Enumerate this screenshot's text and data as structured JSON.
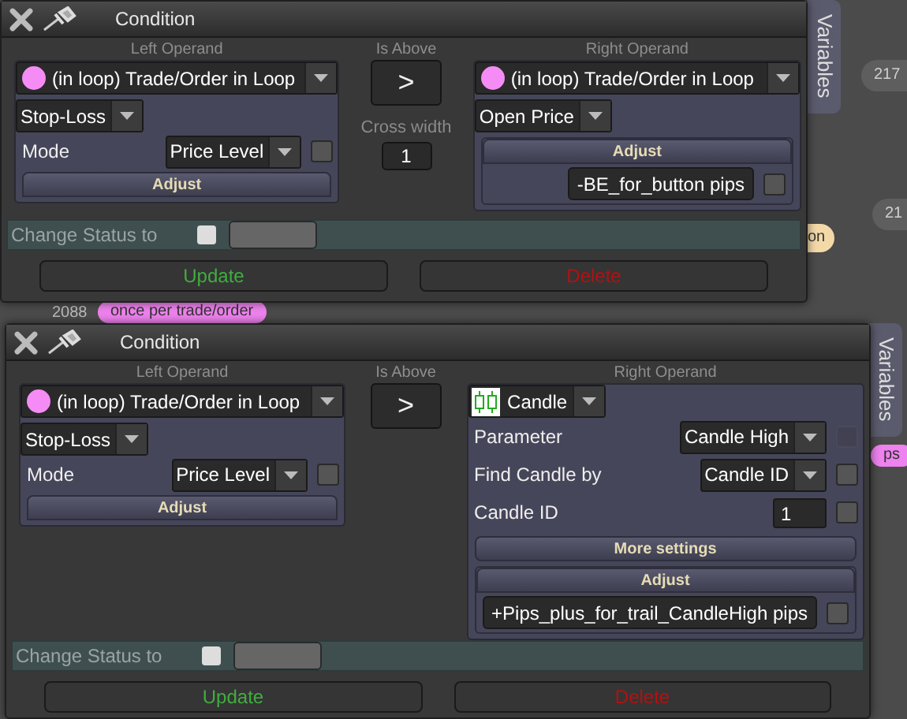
{
  "background": {
    "nodes": [
      {
        "kind": "gray",
        "label": "217"
      },
      {
        "kind": "gray",
        "label": "21"
      },
      {
        "kind": "beige",
        "label": "on"
      },
      {
        "kind": "number",
        "label": "2088"
      },
      {
        "kind": "pink",
        "label": "once per trade/order"
      },
      {
        "kind": "pink",
        "label": "ps"
      }
    ]
  },
  "dialogs": [
    {
      "title": "Condition",
      "side_tab": "Variables",
      "left_operand": {
        "heading": "Left Operand",
        "source": {
          "kind": "loop",
          "label": "(in loop) Trade/Order in Loop"
        },
        "field": "Stop-Loss",
        "rows": [
          {
            "kind": "dropdown",
            "label": "Mode",
            "value": "Price Level",
            "checked": false,
            "disabled": false
          }
        ],
        "adjust": "Adjust"
      },
      "operator": {
        "heading": "Is Above",
        "symbol": ">",
        "cross_width": {
          "label": "Cross width",
          "value": "1"
        }
      },
      "right_operand": {
        "heading": "Right Operand",
        "source": {
          "kind": "loop",
          "label": "(in loop) Trade/Order in Loop"
        },
        "field": "Open Price",
        "adjust": "Adjust",
        "adjust_value": "-BE_for_button pips",
        "adjust_checked": false
      },
      "change_status": {
        "label": "Change Status to",
        "checked": false
      },
      "buttons": [
        {
          "kind": "update",
          "label": "Update"
        },
        {
          "kind": "delete",
          "label": "Delete"
        }
      ]
    },
    {
      "title": "Condition",
      "side_tab": "Variables",
      "left_operand": {
        "heading": "Left Operand",
        "source": {
          "kind": "loop",
          "label": "(in loop) Trade/Order in Loop"
        },
        "field": "Stop-Loss",
        "rows": [
          {
            "kind": "dropdown",
            "label": "Mode",
            "value": "Price Level",
            "checked": false,
            "disabled": false
          }
        ],
        "adjust": "Adjust"
      },
      "operator": {
        "heading": "Is Above",
        "symbol": ">"
      },
      "right_operand": {
        "heading": "Right Operand",
        "source": {
          "kind": "candle",
          "label": "Candle"
        },
        "rows": [
          {
            "kind": "dropdown",
            "label": "Parameter",
            "value": "Candle High",
            "checked": false,
            "disabled": true
          },
          {
            "kind": "dropdown",
            "label": "Find Candle by",
            "value": "Candle ID",
            "checked": false,
            "disabled": false
          },
          {
            "kind": "input",
            "label": "Candle ID",
            "value": "1",
            "checked": false,
            "disabled": false
          }
        ],
        "more_settings": "More settings",
        "adjust": "Adjust",
        "adjust_value": "+Pips_plus_for_trail_CandleHigh pips",
        "adjust_checked": false
      },
      "change_status": {
        "label": "Change Status to",
        "checked": false
      },
      "buttons": [
        {
          "kind": "update",
          "label": "Update"
        },
        {
          "kind": "delete",
          "label": "Delete"
        }
      ]
    }
  ]
}
